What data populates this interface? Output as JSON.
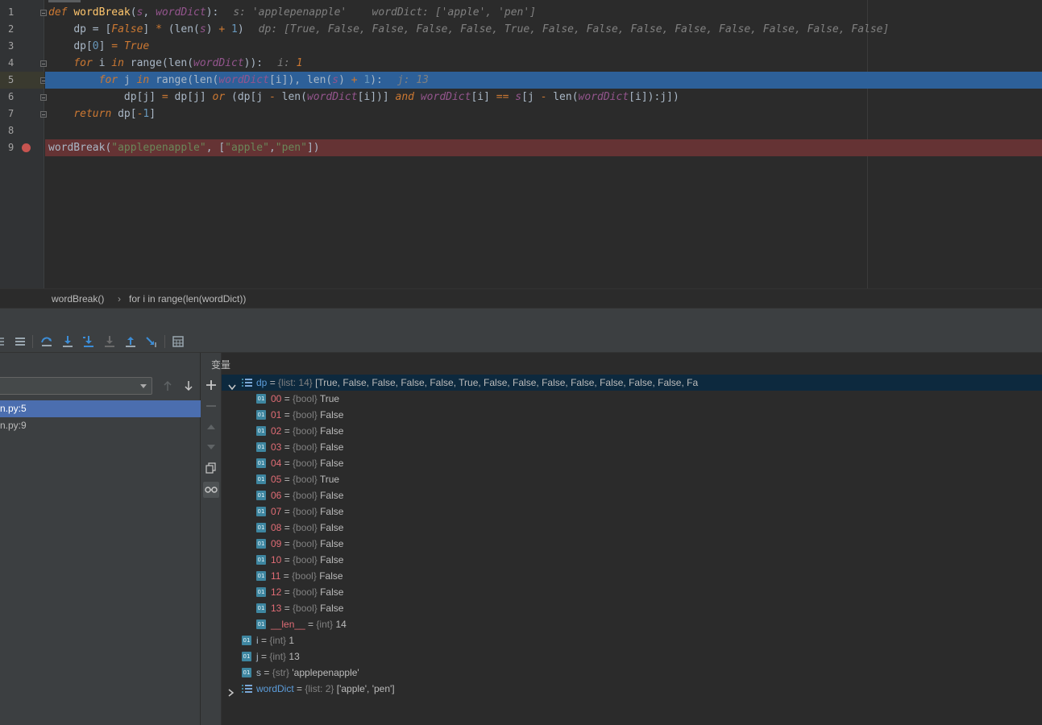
{
  "editor": {
    "line_numbers": [
      "1",
      "2",
      "3",
      "4",
      "5",
      "6",
      "7",
      "8",
      "9"
    ],
    "lines": {
      "l1": {
        "kw": "def",
        "fn": "wordBreak",
        "p_open": "(",
        "s": "s",
        "comma": ", ",
        "wd": "wordDict",
        "p_close": "):",
        "hint": "s: 'applepenapple'    wordDict: ['apple', 'pen']"
      },
      "l2": {
        "a": "dp",
        "eq": " = [",
        "f": "False",
        "b": "] ",
        "op": "*",
        "c": " (len(",
        "s": "s",
        "d": ") ",
        "plus": "+",
        "e": " ",
        "one": "1",
        "g": ")",
        "hint": "dp: [True, False, False, False, False, True, False, False, False, False, False, False, False, False]"
      },
      "l3": {
        "a": "dp[",
        "zero": "0",
        "b": "] ",
        "eq": "=",
        "c": " ",
        "t": "True"
      },
      "l4": {
        "for": "for",
        "a": " i ",
        "in": "in",
        "b": " range(len(",
        "wd": "wordDict",
        "c": ")):",
        "hint_name": "i: ",
        "hint_val": "1"
      },
      "l5": {
        "for": "for",
        "a": " j ",
        "in": "in",
        "b": " range(len(",
        "wd": "wordDict",
        "c": "[i]), len(",
        "s": "s",
        "d": ") ",
        "plus": "+",
        "e": " ",
        "one": "1",
        "f": "):",
        "hint": "j: 13"
      },
      "l6": {
        "a": "dp[j] ",
        "eq": "=",
        "b": " dp[j] ",
        "or": "or",
        "c": " (dp[j ",
        "minus": "-",
        "d": " len(",
        "wd": "wordDict",
        "e": "[i])] ",
        "and": "and",
        "f": " ",
        "wd2": "wordDict",
        "g": "[i] ",
        "eqeq": "==",
        "h": " ",
        "s": "s",
        "i": "[j ",
        "minus2": "-",
        "j": " len(",
        "wd3": "wordDict",
        "k": "[i]):j])"
      },
      "l7": {
        "ret": "return",
        "a": " dp[",
        "minus": "-",
        "one": "1",
        "b": "]"
      },
      "l9": {
        "fn": "wordBreak",
        "a": "(",
        "s1": "\"applepenapple\"",
        "b": ", [",
        "s2": "\"apple\"",
        "c": ",",
        "s3": "\"pen\"",
        "d": "])"
      }
    },
    "breadcrumb": {
      "func": "wordBreak()",
      "sep": "›",
      "loop": "for i in range(len(wordDict))"
    }
  },
  "debugger": {
    "frames": [
      "n.py:5",
      "n.py:9"
    ],
    "variables_title": "变量",
    "dp_row": {
      "name": "dp",
      "eq": " = ",
      "type": "{list: 14}",
      "value": " [True, False, False, False, False, True, False, False, False, False, False, False, False, Fa"
    },
    "dp_items": [
      {
        "name": "00",
        "type": "{bool}",
        "value": "True"
      },
      {
        "name": "01",
        "type": "{bool}",
        "value": "False"
      },
      {
        "name": "02",
        "type": "{bool}",
        "value": "False"
      },
      {
        "name": "03",
        "type": "{bool}",
        "value": "False"
      },
      {
        "name": "04",
        "type": "{bool}",
        "value": "False"
      },
      {
        "name": "05",
        "type": "{bool}",
        "value": "True"
      },
      {
        "name": "06",
        "type": "{bool}",
        "value": "False"
      },
      {
        "name": "07",
        "type": "{bool}",
        "value": "False"
      },
      {
        "name": "08",
        "type": "{bool}",
        "value": "False"
      },
      {
        "name": "09",
        "type": "{bool}",
        "value": "False"
      },
      {
        "name": "10",
        "type": "{bool}",
        "value": "False"
      },
      {
        "name": "11",
        "type": "{bool}",
        "value": "False"
      },
      {
        "name": "12",
        "type": "{bool}",
        "value": "False"
      },
      {
        "name": "13",
        "type": "{bool}",
        "value": "False"
      },
      {
        "name": "__len__",
        "type": "{int}",
        "value": "14"
      }
    ],
    "other_vars": [
      {
        "name": "i",
        "type": "{int}",
        "value": "1"
      },
      {
        "name": "j",
        "type": "{int}",
        "value": "13"
      },
      {
        "name": "s",
        "type": "{str}",
        "value": "'applepenapple'"
      }
    ],
    "worddict_row": {
      "name": "wordDict",
      "type": "{list: 2}",
      "value": "['apple', 'pen']"
    },
    "icon_label": "01"
  },
  "colors": {
    "exec_line": "#2d6099",
    "breakpoint_line": "#653334",
    "breakpoint_dot": "#c75450",
    "selected_frame": "#4b6eaf"
  }
}
